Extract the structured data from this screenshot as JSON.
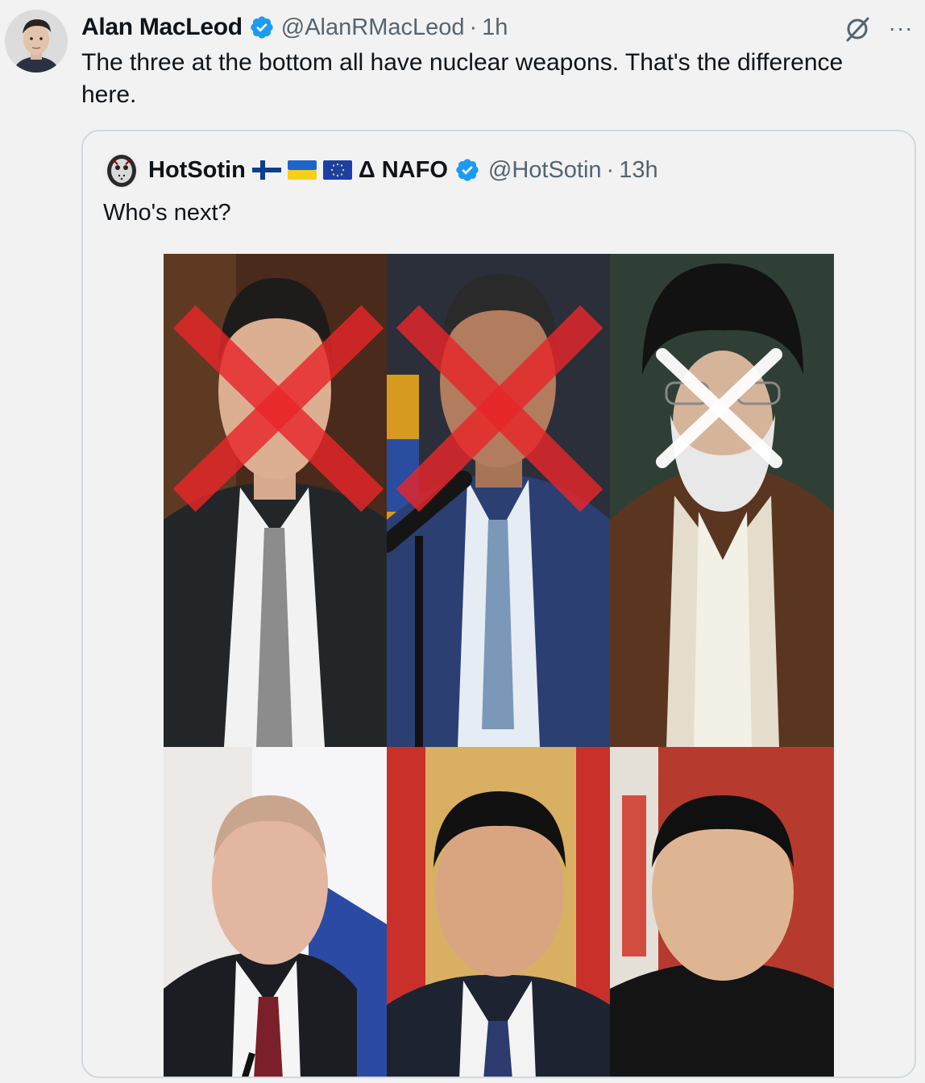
{
  "tweet": {
    "author_name": "Alan MacLeod",
    "handle": "@AlanRMacLeod",
    "separator": "·",
    "time": "1h",
    "text": "The three at the bottom all have nuclear weapons. That's the difference here.",
    "more_label": "···",
    "icons": {
      "verified": "verified-badge-icon",
      "grok": "grok-icon",
      "more": "more-icon"
    }
  },
  "quote": {
    "author_name": "HotSotin",
    "badge_text": "Δ NAFO",
    "handle": "@HotSotin",
    "separator": "·",
    "time": "13h",
    "text": "Who's next?",
    "flags": [
      "finland-flag-icon",
      "ukraine-flag-icon",
      "eu-flag-icon"
    ]
  },
  "media": {
    "crossed_out": [
      true,
      true,
      true,
      false,
      false,
      false
    ],
    "cross_colors": [
      "#e8262a",
      "#e8262a",
      "#ffffff"
    ]
  },
  "colors": {
    "verified_blue": "#1d9bf0",
    "secondary_text": "#536471",
    "border": "#cfd9de",
    "background": "#f2f2f2"
  }
}
